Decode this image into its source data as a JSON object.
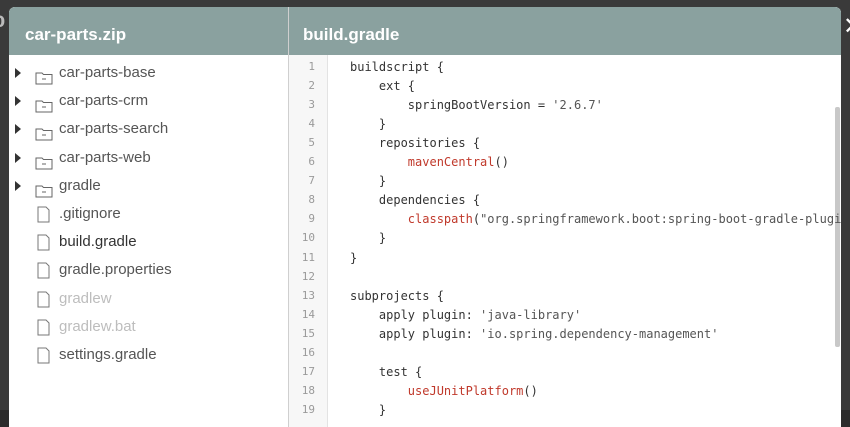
{
  "left_panel": {
    "title": "car-parts.zip"
  },
  "right_panel": {
    "title": "build.gradle"
  },
  "tree": [
    {
      "label": "car-parts-base",
      "kind": "folder"
    },
    {
      "label": "car-parts-crm",
      "kind": "folder"
    },
    {
      "label": "car-parts-search",
      "kind": "folder"
    },
    {
      "label": "car-parts-web",
      "kind": "folder"
    },
    {
      "label": "gradle",
      "kind": "folder"
    },
    {
      "label": ".gitignore",
      "kind": "file"
    },
    {
      "label": "build.gradle",
      "kind": "file",
      "state": "active"
    },
    {
      "label": "gradle.properties",
      "kind": "file"
    },
    {
      "label": "gradlew",
      "kind": "file",
      "state": "disabled"
    },
    {
      "label": "gradlew.bat",
      "kind": "file",
      "state": "disabled"
    },
    {
      "label": "settings.gradle",
      "kind": "file"
    }
  ],
  "code_lines": [
    {
      "n": "1",
      "segs": [
        [
          "t",
          "buildscript {"
        ]
      ]
    },
    {
      "n": "2",
      "segs": [
        [
          "t",
          "    ext {"
        ]
      ]
    },
    {
      "n": "3",
      "segs": [
        [
          "t",
          "        springBootVersion = "
        ],
        [
          "s",
          "'2.6.7'"
        ]
      ]
    },
    {
      "n": "4",
      "segs": [
        [
          "t",
          "    }"
        ]
      ]
    },
    {
      "n": "5",
      "segs": [
        [
          "t",
          "    repositories {"
        ]
      ]
    },
    {
      "n": "6",
      "segs": [
        [
          "t",
          "        "
        ],
        [
          "f",
          "mavenCentral"
        ],
        [
          "t",
          "()"
        ]
      ]
    },
    {
      "n": "7",
      "segs": [
        [
          "t",
          "    }"
        ]
      ]
    },
    {
      "n": "8",
      "segs": [
        [
          "t",
          "    dependencies {"
        ]
      ]
    },
    {
      "n": "9",
      "segs": [
        [
          "t",
          "        "
        ],
        [
          "f",
          "classpath"
        ],
        [
          "t",
          "("
        ],
        [
          "s",
          "\"org.springframework.boot:spring-boot-gradle-plugin"
        ]
      ]
    },
    {
      "n": "10",
      "segs": [
        [
          "t",
          "    }"
        ]
      ]
    },
    {
      "n": "11",
      "segs": [
        [
          "t",
          "}"
        ]
      ]
    },
    {
      "n": "12",
      "segs": []
    },
    {
      "n": "13",
      "segs": [
        [
          "t",
          "subprojects {"
        ]
      ]
    },
    {
      "n": "14",
      "segs": [
        [
          "t",
          "    apply plugin: "
        ],
        [
          "s",
          "'java-library'"
        ]
      ]
    },
    {
      "n": "15",
      "segs": [
        [
          "t",
          "    apply plugin: "
        ],
        [
          "s",
          "'io.spring.dependency-management'"
        ]
      ]
    },
    {
      "n": "16",
      "segs": []
    },
    {
      "n": "17",
      "segs": [
        [
          "t",
          "    test {"
        ]
      ]
    },
    {
      "n": "18",
      "segs": [
        [
          "t",
          "        "
        ],
        [
          "f",
          "useJUnitPlatform"
        ],
        [
          "t",
          "()"
        ]
      ]
    },
    {
      "n": "19",
      "segs": [
        [
          "t",
          "    }"
        ]
      ]
    }
  ],
  "colors": {
    "header": "#8aa19f",
    "function": "#c0392b"
  },
  "icons": {
    "folder": "folder-icon",
    "file": "file-icon",
    "close": "close-icon",
    "expand": "caret-right-icon"
  }
}
